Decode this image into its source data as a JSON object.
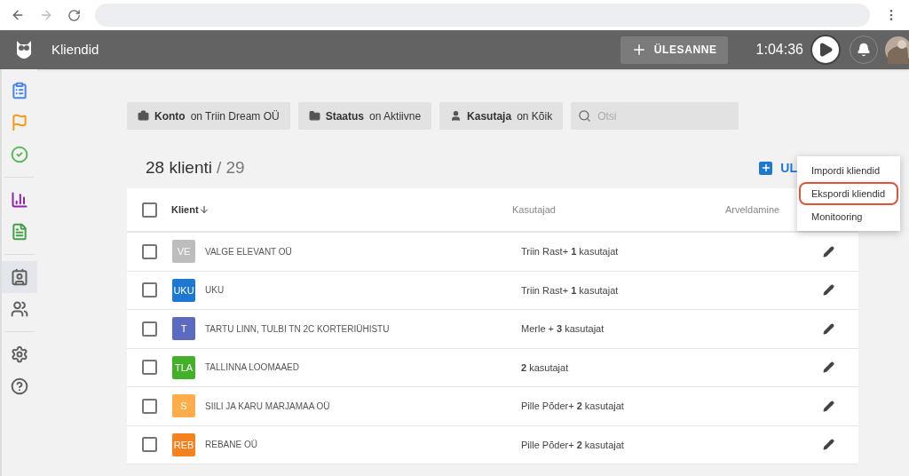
{
  "header": {
    "title": "Kliendid",
    "task_button": "ÜLESANNE",
    "timer": "1:04:36"
  },
  "sidebar": {
    "items": [
      {
        "color": "#4a86e8",
        "selected": false
      },
      {
        "color": "#f29b1d",
        "selected": false
      },
      {
        "color": "#5cb85c",
        "selected": false
      },
      {
        "color": "#8e24aa",
        "selected": false
      },
      {
        "color": "#43a047",
        "selected": false
      },
      {
        "color": "#616161",
        "selected": true
      },
      {
        "color": "#616161",
        "selected": false
      },
      {
        "color": "#616161",
        "selected": false
      },
      {
        "color": "#616161",
        "selected": false
      }
    ]
  },
  "filters": [
    {
      "label": "Konto",
      "value": "on Triin Dream OÜ"
    },
    {
      "label": "Staatus",
      "value": "on Aktiivne"
    },
    {
      "label": "Kasutaja",
      "value": "on Kõik"
    }
  ],
  "search": {
    "placeholder": "Otsi"
  },
  "count": {
    "shown": "28 klienti",
    "total": "/ 29"
  },
  "add_button": "UL",
  "menu": [
    {
      "label": "Impordi kliendid",
      "highlighted": false
    },
    {
      "label": "Ekspordi kliendid",
      "highlighted": true
    },
    {
      "label": "Monitooring",
      "highlighted": false
    }
  ],
  "table": {
    "all_checked": false,
    "columns": [
      "Klient",
      "Kasutajad",
      "Arveldamine"
    ],
    "rows": [
      {
        "initials": "VE",
        "color": "#bdbdbd",
        "name": "VALGE ELEVANT OÜ",
        "users": "Triin Rast+ **1** kasutajat",
        "checked": false
      },
      {
        "initials": "UKU",
        "color": "#1e78d2",
        "name": "UKU",
        "users": "Triin Rast+ **1** kasutajat",
        "checked": false
      },
      {
        "initials": "T",
        "color": "#5c6bc0",
        "name": "TARTU LINN, TULBI TN 2C KORTERIÜHISTU",
        "users": "Merle + **3** kasutajat",
        "checked": false
      },
      {
        "initials": "TLA",
        "color": "#43b02a",
        "name": "TALLINNA LOOMAAED",
        "users": "**2** kasutajat",
        "checked": false
      },
      {
        "initials": "S",
        "color": "#ffad4a",
        "name": "SIILI JA KARU MARJAMAA OÜ",
        "users": "Pille Põder+ **2** kasutajat",
        "checked": false
      },
      {
        "initials": "REB",
        "color": "#f58220",
        "name": "REBANE OÜ",
        "users": "Pille Põder+ **2** kasutajat",
        "checked": false
      }
    ]
  }
}
